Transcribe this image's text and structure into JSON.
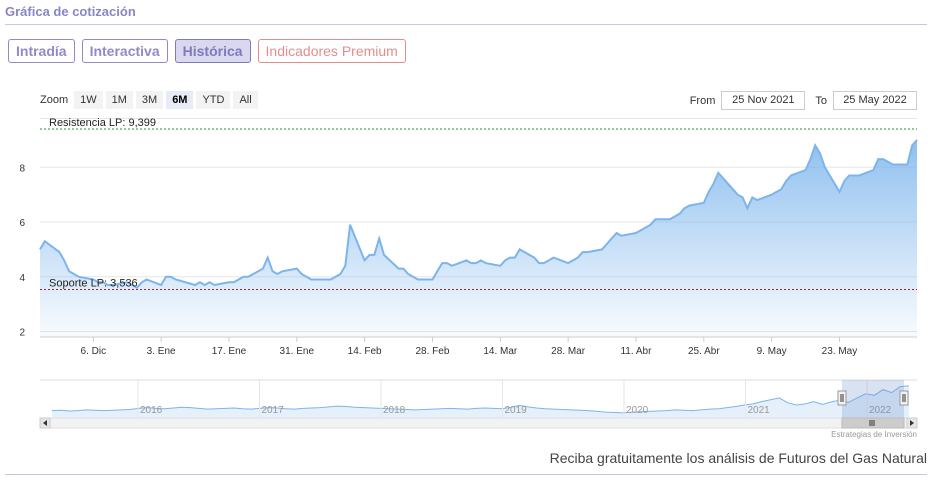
{
  "header": {
    "title": "Gráfica de cotización"
  },
  "tabs": [
    {
      "label": "Intradía"
    },
    {
      "label": "Interactiva"
    },
    {
      "label": "Histórica"
    },
    {
      "label": "Indicadores Premium"
    }
  ],
  "zoom": {
    "label": "Zoom",
    "buttons": [
      "1W",
      "1M",
      "3M",
      "6M",
      "YTD",
      "All"
    ],
    "selected": "6M"
  },
  "range": {
    "from_label": "From",
    "from_value": "25 Nov 2021",
    "to_label": "To",
    "to_value": "25 May 2022"
  },
  "colors": {
    "accent": "#8a86c4",
    "series": "#7cb5ec",
    "resistance": "#2e8b2e",
    "support": "#a31d2c"
  },
  "chart_data": {
    "type": "area",
    "x_tick_labels": [
      "6. Dic",
      "3. Ene",
      "17. Ene",
      "31. Ene",
      "14. Feb",
      "28. Feb",
      "14. Mar",
      "28. Mar",
      "11. Abr",
      "25. Abr",
      "9. May",
      "23. May"
    ],
    "y_ticks": [
      2,
      4,
      6,
      8
    ],
    "ylim": [
      1.8,
      9.8
    ],
    "x_start": "2021-12-01",
    "series": [
      {
        "values": [
          [
            "2021-11-25",
            5.0
          ],
          [
            "2021-11-26",
            5.3
          ],
          [
            "2021-11-29",
            4.9
          ],
          [
            "2021-11-30",
            4.6
          ],
          [
            "2021-12-01",
            4.2
          ],
          [
            "2021-12-02",
            4.1
          ],
          [
            "2021-12-03",
            4.0
          ],
          [
            "2021-12-06",
            3.9
          ],
          [
            "2021-12-07",
            3.8
          ],
          [
            "2021-12-08",
            3.8
          ],
          [
            "2021-12-09",
            3.7
          ],
          [
            "2021-12-10",
            3.7
          ],
          [
            "2021-12-13",
            3.8
          ],
          [
            "2021-12-14",
            3.7
          ],
          [
            "2021-12-15",
            3.6
          ],
          [
            "2021-12-16",
            3.8
          ],
          [
            "2021-12-17",
            3.9
          ],
          [
            "2021-12-20",
            3.7
          ],
          [
            "2021-12-21",
            4.0
          ],
          [
            "2021-12-22",
            4.0
          ],
          [
            "2021-12-23",
            3.9
          ],
          [
            "2021-12-27",
            3.7
          ],
          [
            "2021-12-28",
            3.8
          ],
          [
            "2021-12-29",
            3.7
          ],
          [
            "2021-12-30",
            3.8
          ],
          [
            "2021-12-31",
            3.7
          ],
          [
            "2022-01-03",
            3.8
          ],
          [
            "2022-01-04",
            3.8
          ],
          [
            "2022-01-05",
            3.9
          ],
          [
            "2022-01-06",
            4.0
          ],
          [
            "2022-01-07",
            4.0
          ],
          [
            "2022-01-10",
            4.3
          ],
          [
            "2022-01-11",
            4.7
          ],
          [
            "2022-01-12",
            4.2
          ],
          [
            "2022-01-13",
            4.1
          ],
          [
            "2022-01-14",
            4.2
          ],
          [
            "2022-01-17",
            4.3
          ],
          [
            "2022-01-18",
            4.1
          ],
          [
            "2022-01-19",
            4.0
          ],
          [
            "2022-01-20",
            3.9
          ],
          [
            "2022-01-21",
            3.9
          ],
          [
            "2022-01-24",
            3.9
          ],
          [
            "2022-01-25",
            4.0
          ],
          [
            "2022-01-26",
            4.1
          ],
          [
            "2022-01-27",
            4.4
          ],
          [
            "2022-01-28",
            5.9
          ],
          [
            "2022-01-31",
            4.6
          ],
          [
            "2022-02-01",
            4.8
          ],
          [
            "2022-02-02",
            4.8
          ],
          [
            "2022-02-03",
            5.4
          ],
          [
            "2022-02-04",
            4.8
          ],
          [
            "2022-02-07",
            4.3
          ],
          [
            "2022-02-08",
            4.3
          ],
          [
            "2022-02-09",
            4.1
          ],
          [
            "2022-02-10",
            4.0
          ],
          [
            "2022-02-11",
            3.9
          ],
          [
            "2022-02-14",
            3.9
          ],
          [
            "2022-02-15",
            4.2
          ],
          [
            "2022-02-16",
            4.5
          ],
          [
            "2022-02-17",
            4.5
          ],
          [
            "2022-02-18",
            4.4
          ],
          [
            "2022-02-21",
            4.6
          ],
          [
            "2022-02-22",
            4.5
          ],
          [
            "2022-02-23",
            4.5
          ],
          [
            "2022-02-24",
            4.6
          ],
          [
            "2022-02-25",
            4.5
          ],
          [
            "2022-02-28",
            4.4
          ],
          [
            "2022-03-01",
            4.6
          ],
          [
            "2022-03-02",
            4.7
          ],
          [
            "2022-03-03",
            4.7
          ],
          [
            "2022-03-04",
            5.0
          ],
          [
            "2022-03-07",
            4.7
          ],
          [
            "2022-03-08",
            4.5
          ],
          [
            "2022-03-09",
            4.5
          ],
          [
            "2022-03-10",
            4.6
          ],
          [
            "2022-03-11",
            4.7
          ],
          [
            "2022-03-14",
            4.5
          ],
          [
            "2022-03-15",
            4.6
          ],
          [
            "2022-03-16",
            4.7
          ],
          [
            "2022-03-17",
            4.9
          ],
          [
            "2022-03-18",
            4.9
          ],
          [
            "2022-03-21",
            5.0
          ],
          [
            "2022-03-22",
            5.2
          ],
          [
            "2022-03-23",
            5.4
          ],
          [
            "2022-03-24",
            5.6
          ],
          [
            "2022-03-25",
            5.5
          ],
          [
            "2022-03-28",
            5.6
          ],
          [
            "2022-03-29",
            5.7
          ],
          [
            "2022-03-30",
            5.8
          ],
          [
            "2022-03-31",
            5.9
          ],
          [
            "2022-04-01",
            6.1
          ],
          [
            "2022-04-04",
            6.1
          ],
          [
            "2022-04-05",
            6.2
          ],
          [
            "2022-04-06",
            6.3
          ],
          [
            "2022-04-07",
            6.5
          ],
          [
            "2022-04-08",
            6.6
          ],
          [
            "2022-04-11",
            6.7
          ],
          [
            "2022-04-12",
            7.1
          ],
          [
            "2022-04-13",
            7.4
          ],
          [
            "2022-04-14",
            7.8
          ],
          [
            "2022-04-18",
            7.0
          ],
          [
            "2022-04-19",
            6.9
          ],
          [
            "2022-04-20",
            6.5
          ],
          [
            "2022-04-21",
            6.9
          ],
          [
            "2022-04-22",
            6.8
          ],
          [
            "2022-04-25",
            7.0
          ],
          [
            "2022-04-26",
            7.1
          ],
          [
            "2022-04-27",
            7.2
          ],
          [
            "2022-04-28",
            7.5
          ],
          [
            "2022-04-29",
            7.7
          ],
          [
            "2022-05-02",
            7.9
          ],
          [
            "2022-05-03",
            8.3
          ],
          [
            "2022-05-04",
            8.8
          ],
          [
            "2022-05-05",
            8.5
          ],
          [
            "2022-05-06",
            8.0
          ],
          [
            "2022-05-09",
            7.1
          ],
          [
            "2022-05-10",
            7.5
          ],
          [
            "2022-05-11",
            7.7
          ],
          [
            "2022-05-12",
            7.7
          ],
          [
            "2022-05-13",
            7.7
          ],
          [
            "2022-05-16",
            7.9
          ],
          [
            "2022-05-17",
            8.3
          ],
          [
            "2022-05-18",
            8.3
          ],
          [
            "2022-05-19",
            8.2
          ],
          [
            "2022-05-20",
            8.1
          ],
          [
            "2022-05-23",
            8.1
          ],
          [
            "2022-05-24",
            8.8
          ],
          [
            "2022-05-25",
            9.0
          ]
        ]
      }
    ],
    "annotations": [
      {
        "label": "Resistencia LP: 9,399",
        "value": 9.399,
        "color": "#2e8b2e"
      },
      {
        "label": "Soporte LP: 3,536",
        "value": 3.536,
        "color": "#a31d2c"
      }
    ],
    "navigator": {
      "year_labels": [
        "2016",
        "2017",
        "2018",
        "2019",
        "2020",
        "2021",
        "2022"
      ],
      "values": [
        2.4,
        2.5,
        2.3,
        2.4,
        2.6,
        2.5,
        2.4,
        2.5,
        2.6,
        2.7,
        3.0,
        3.2,
        3.0,
        2.9,
        3.1,
        3.3,
        3.2,
        3.0,
        2.8,
        2.9,
        3.0,
        3.1,
        2.9,
        2.8,
        3.0,
        3.2,
        3.1,
        2.9,
        2.8,
        3.0,
        3.1,
        3.2,
        3.4,
        3.6,
        3.5,
        3.3,
        3.2,
        3.1,
        3.0,
        2.9,
        2.8,
        2.7,
        2.6,
        2.7,
        2.8,
        2.9,
        3.0,
        2.9,
        2.8,
        3.0,
        3.1,
        3.0,
        2.9,
        3.3,
        3.8,
        3.4,
        3.1,
        2.9,
        2.8,
        2.7,
        2.6,
        2.5,
        2.4,
        2.2,
        2.0,
        1.9,
        1.8,
        2.0,
        2.1,
        2.2,
        2.3,
        2.4,
        2.6,
        2.5,
        2.4,
        2.6,
        2.8,
        2.9,
        3.2,
        3.5,
        3.9,
        4.2,
        4.8,
        5.3,
        5.8,
        4.5,
        3.9,
        4.2,
        4.8,
        4.1,
        4.7,
        5.2,
        4.6,
        5.8,
        6.9,
        6.5,
        8.0,
        7.2,
        8.8,
        9.0
      ]
    }
  },
  "credit": "Estrategias de Inversión",
  "promo": "Reciba gratuitamente los análisis de Futuros del Gas Natural"
}
